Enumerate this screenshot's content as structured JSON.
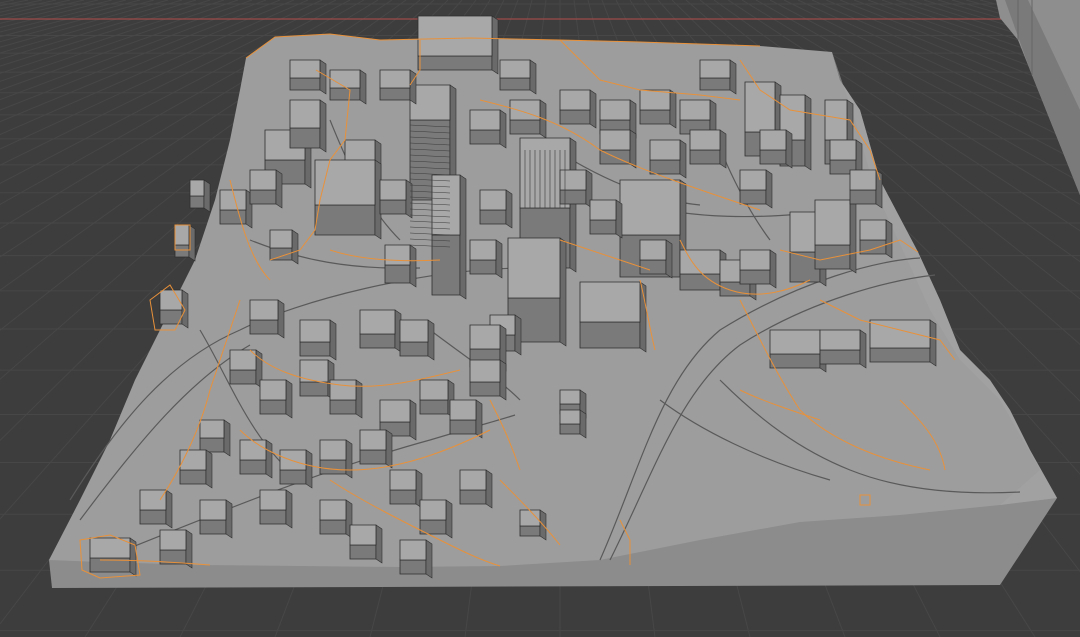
{
  "app": {
    "name": "",
    "view": "3d-viewport"
  },
  "scene": {
    "subject": "city-terrain-model",
    "selection_outline_color": "#e8913a",
    "background_color": "#3d3d3d",
    "grid_line_color": "#474747",
    "x_axis_color": "#b24a4a",
    "model_top_color": "#9d9d9d",
    "model_side_color": "#8c8c8c",
    "building_top_color": "#a8a8a8",
    "building_side_color": "#7a7a7a",
    "building_edge_color": "#2e2e2e",
    "road_line_color": "#5a5a5a"
  },
  "icons": [
    "selection-outline",
    "building-block"
  ]
}
